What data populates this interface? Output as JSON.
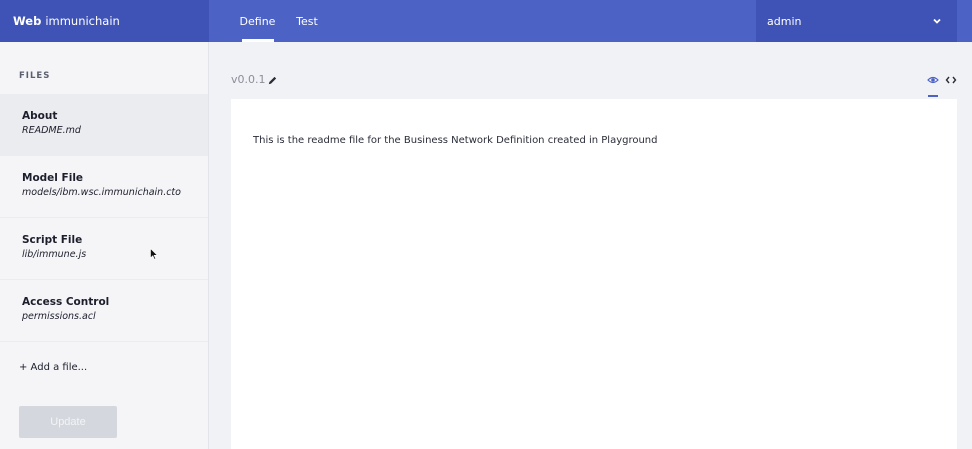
{
  "app": {
    "brand_prefix": "Web",
    "brand_name": "immunichain"
  },
  "nav": {
    "tabs": [
      {
        "label": "Define",
        "active": true
      },
      {
        "label": "Test",
        "active": false
      }
    ]
  },
  "user": {
    "name": "admin"
  },
  "sidebar": {
    "heading": "FILES",
    "files": [
      {
        "title": "About",
        "path": "README.md",
        "active": true
      },
      {
        "title": "Model File",
        "path": "models/ibm.wsc.immunichain.cto",
        "active": false
      },
      {
        "title": "Script File",
        "path": "lib/immune.js",
        "active": false
      },
      {
        "title": "Access Control",
        "path": "permissions.acl",
        "active": false
      }
    ],
    "add_file_label": "+ Add a file...",
    "update_label": "Update"
  },
  "editor": {
    "version": "v0.0.1",
    "readme_text": "This is the readme file for the Business Network Definition created in Playground"
  },
  "colors": {
    "brand": "#3e53b5",
    "nav": "#4d62c5",
    "accent": "#4d62c5"
  },
  "icons": [
    "pencil-icon",
    "eye-icon",
    "code-icon",
    "chevron-down-icon",
    "mouse-cursor-icon"
  ]
}
